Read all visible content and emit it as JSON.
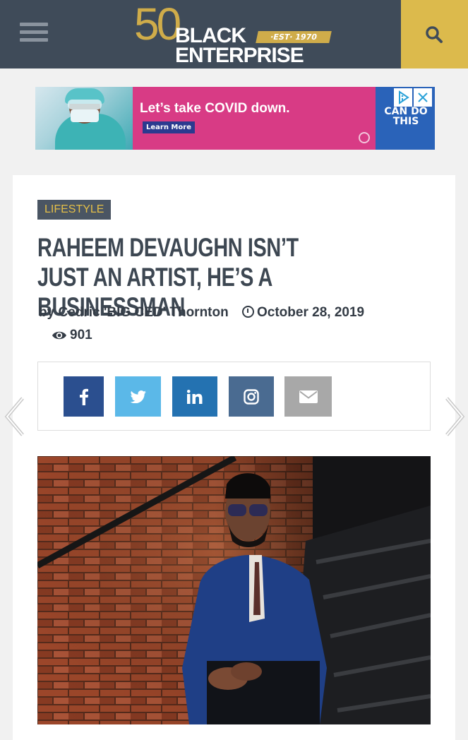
{
  "header": {
    "logo": {
      "number": "50",
      "line1": "BLACK",
      "est": "·EST· 1970",
      "line2": "ENTERPRISE"
    },
    "colors": {
      "bar": "#3f4b59",
      "gold": "#dcba4c"
    }
  },
  "ad": {
    "headline": "Let’s take COVID down.",
    "cta": "Learn More",
    "side_text": "CAN DO THIS"
  },
  "article": {
    "category": "LIFESTYLE",
    "title": "RAHEEM DEVAUGHN ISN’T JUST AN ARTIST, HE’S A BUSINESSMAN",
    "author_line": "by Cedric 'BIG CED' Thornton",
    "date": "October 28, 2019",
    "views": "901"
  },
  "share": {
    "buttons": [
      {
        "name": "facebook",
        "color": "#2b4f8f"
      },
      {
        "name": "twitter",
        "color": "#5bb8e8"
      },
      {
        "name": "linkedin",
        "color": "#2472b1"
      },
      {
        "name": "instagram",
        "color": "#4a6b91"
      },
      {
        "name": "email",
        "color": "#a8a8a8"
      }
    ]
  }
}
